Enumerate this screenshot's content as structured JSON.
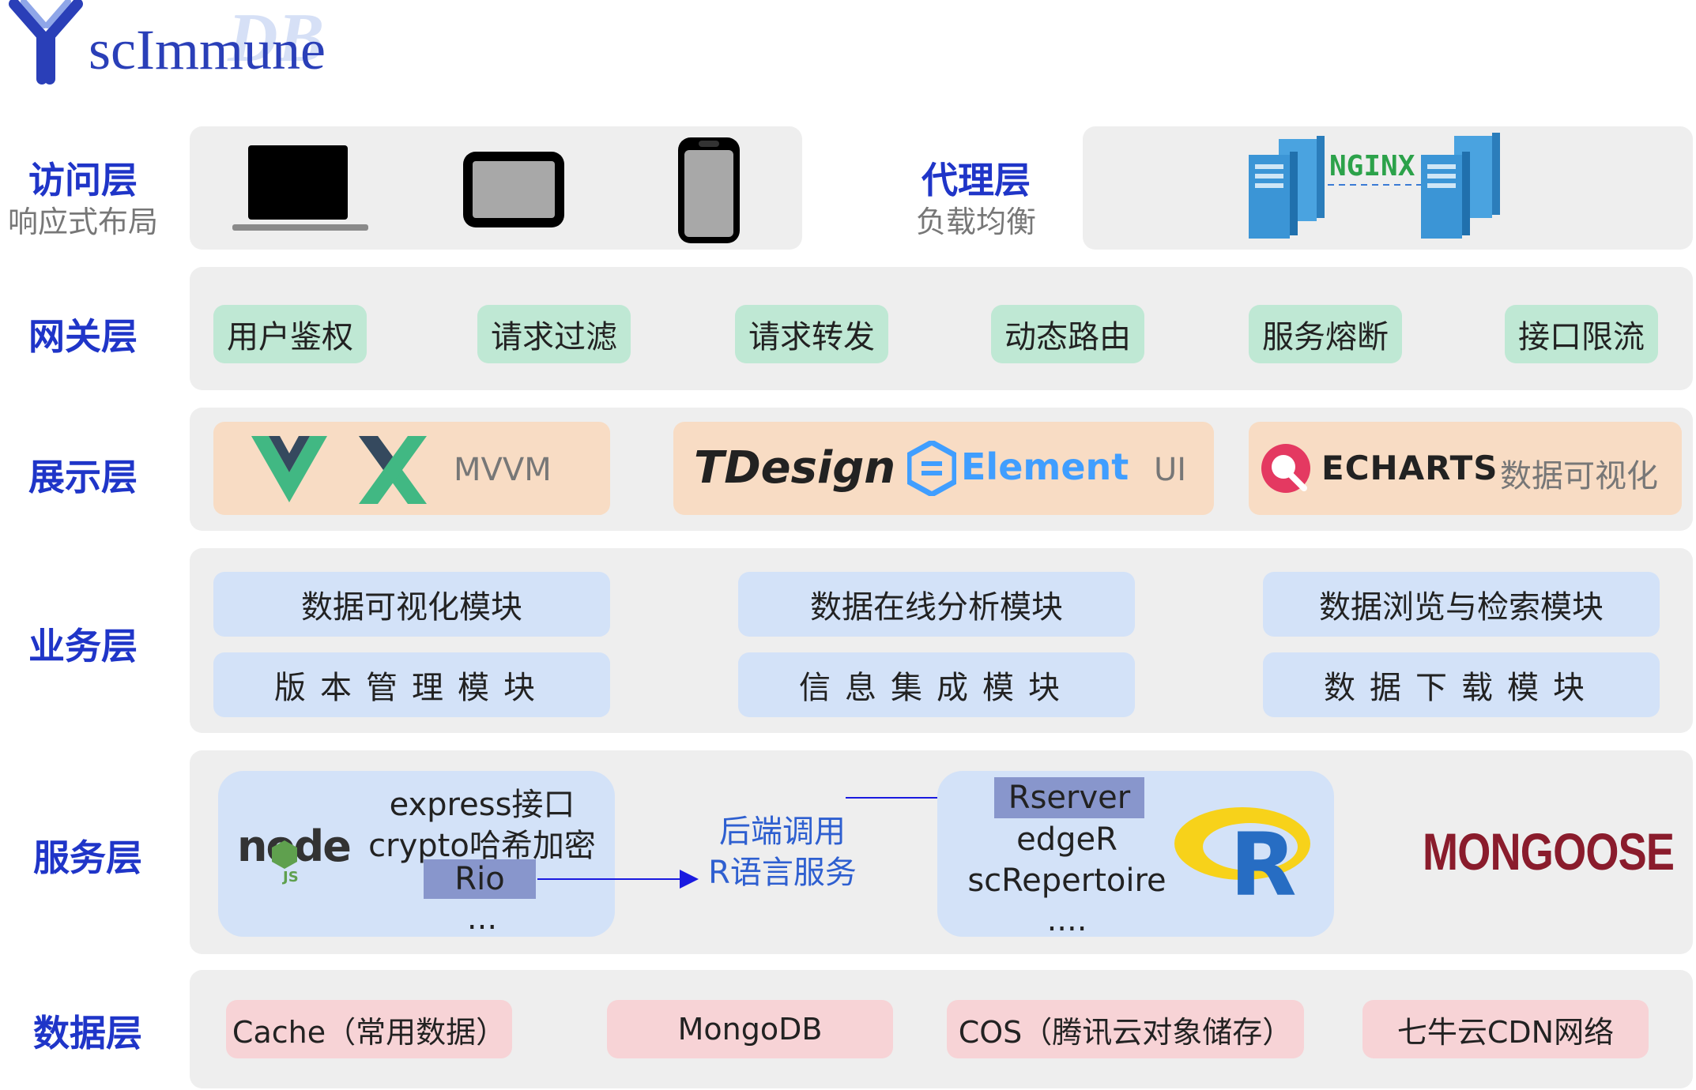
{
  "logo": {
    "main": "scImmune",
    "ghost": "DB"
  },
  "layers": {
    "access": {
      "name": "访问层",
      "sub": "响应式布局"
    },
    "proxy": {
      "name": "代理层",
      "sub": "负载均衡",
      "nginx": "NGINX"
    },
    "gateway": {
      "name": "网关层",
      "items": [
        "用户鉴权",
        "请求过滤",
        "请求转发",
        "动态路由",
        "服务熔断",
        "接口限流"
      ]
    },
    "display": {
      "name": "展示层",
      "mvvm": "MVVM",
      "tdesign": "TDesign",
      "element": "Element",
      "ui": "UI",
      "echarts": "ECHARTS",
      "viz": "数据可视化"
    },
    "business": {
      "name": "业务层",
      "modules": [
        "数据可视化模块",
        "数据在线分析模块",
        "数据浏览与检索模块",
        "版本管理模块",
        "信息集成模块",
        "数据下载模块"
      ]
    },
    "service": {
      "name": "服务层",
      "node_label": "node",
      "node_js": "JS",
      "node_items": [
        "express接口",
        "crypto哈希加密",
        "Rio",
        "..."
      ],
      "middle": [
        "后端调用",
        "R语言服务"
      ],
      "r_items": [
        "Rserver",
        "edgeR",
        "scRepertoire",
        "...."
      ],
      "r_logo": "R",
      "mongoose": "MONGOOSE"
    },
    "data": {
      "name": "数据层",
      "items": [
        "Cache（常用数据）",
        "MongoDB",
        "COS（腾讯云对象储存）",
        "七牛云CDN网络"
      ]
    }
  },
  "colors": {
    "layer_title": "#1f35c8",
    "gateway_chip": "#bfe8d4",
    "display_chip": "#f8dcc4",
    "business_chip": "#d3e2f8",
    "data_chip": "#f7d3d6",
    "highlight": "#8896cc"
  }
}
